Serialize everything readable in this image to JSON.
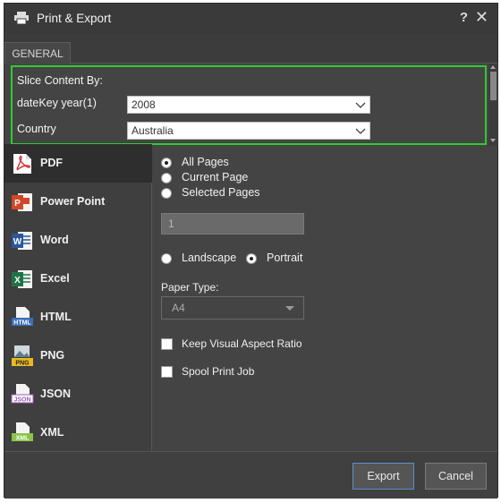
{
  "window": {
    "title": "Print & Export",
    "help": "?",
    "close": "✕"
  },
  "tabs": [
    {
      "label": "GENERAL",
      "active": true
    }
  ],
  "slice": {
    "title": "Slice Content By:",
    "fields": [
      {
        "label": "dateKey year(1)",
        "value": "2008"
      },
      {
        "label": "Country",
        "value": "Australia"
      }
    ],
    "highlight_color": "#2ecc2e"
  },
  "formats": [
    {
      "label": "PDF",
      "icon": "pdf-icon",
      "selected": true
    },
    {
      "label": "Power Point",
      "icon": "powerpoint-icon",
      "selected": false
    },
    {
      "label": "Word",
      "icon": "word-icon",
      "selected": false
    },
    {
      "label": "Excel",
      "icon": "excel-icon",
      "selected": false
    },
    {
      "label": "HTML",
      "icon": "html-icon",
      "selected": false
    },
    {
      "label": "PNG",
      "icon": "png-icon",
      "selected": false
    },
    {
      "label": "JSON",
      "icon": "json-icon",
      "selected": false
    },
    {
      "label": "XML",
      "icon": "xml-icon",
      "selected": false
    }
  ],
  "format_icon_text": {
    "html": "HTML",
    "png": "PNG",
    "json": "JSON",
    "xml": "XML"
  },
  "options": {
    "pages": [
      {
        "label": "All Pages",
        "checked": true
      },
      {
        "label": "Current Page",
        "checked": false
      },
      {
        "label": "Selected Pages",
        "checked": false
      }
    ],
    "page_input_value": "1",
    "orientation": [
      {
        "label": "Landscape",
        "checked": false
      },
      {
        "label": "Portrait",
        "checked": true
      }
    ],
    "paper_type_label": "Paper Type:",
    "paper_type_value": "A4",
    "checkboxes": [
      {
        "label": "Keep Visual Aspect Ratio",
        "checked": false
      },
      {
        "label": "Spool Print Job",
        "checked": false
      }
    ]
  },
  "footer": {
    "export_label": "Export",
    "cancel_label": "Cancel"
  },
  "colors": {
    "dialog_bg": "#444444",
    "selected_format_bg": "#2e2e2e",
    "primary_border": "#5d8fd0"
  }
}
